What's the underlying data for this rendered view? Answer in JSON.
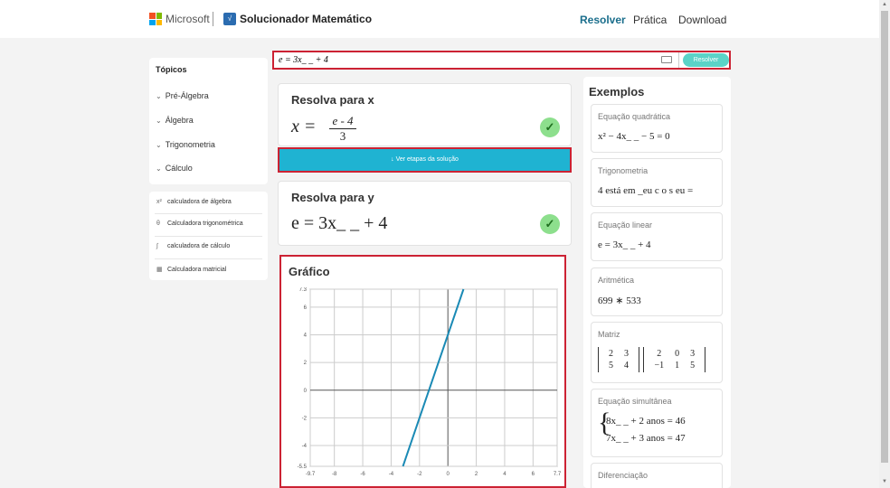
{
  "header": {
    "brand": "Microsoft",
    "app_title": "Solucionador Matemático",
    "nav": [
      "Resolver",
      "Prática",
      "Download"
    ],
    "logo_colors": [
      "#f25022",
      "#7fba00",
      "#00a4ef",
      "#ffb900"
    ]
  },
  "sidebar": {
    "topics_title": "Tópicos",
    "topics": [
      "Pré-Álgebra",
      "Álgebra",
      "Trigonometria",
      "Cálculo"
    ],
    "calculators": [
      {
        "icon": "x²",
        "label": "calculadora de álgebra"
      },
      {
        "icon": "θ",
        "label": "Calculadora trigonométrica"
      },
      {
        "icon": "∫",
        "label": "calculadora de cálculo"
      },
      {
        "icon": "▦",
        "label": "Calculadora matricial"
      }
    ]
  },
  "search": {
    "value": "e = 3x_ _ + 4",
    "button": "Resolver"
  },
  "results": {
    "solve_x_title": "Resolva para x",
    "x_var": "x",
    "x_num": "e - 4",
    "x_den": "3",
    "steps_button": "↓ Ver etapas da solução",
    "solve_y_title": "Resolva para y",
    "y_expr": "e = 3x_ _ + 4",
    "check": "✓"
  },
  "graph": {
    "title": "Gráfico"
  },
  "chart_data": {
    "type": "line",
    "title": "",
    "xlabel": "",
    "ylabel": "",
    "xlim": [
      -9.7,
      7.7
    ],
    "ylim": [
      -5.5,
      7.3
    ],
    "x_ticks": [
      "-9.7",
      "-8",
      "-6",
      "-4",
      "-2",
      "0",
      "2",
      "4",
      "6",
      "7.7"
    ],
    "y_ticks": [
      "7.3",
      "6",
      "4",
      "2",
      "0",
      "-2",
      "-4",
      "-5.5"
    ],
    "series": [
      {
        "x": [
          -3.167,
          1.1
        ],
        "y": [
          -5.5,
          7.3
        ]
      }
    ],
    "line_color": "#1a8ab5",
    "grid": true
  },
  "examples": {
    "title": "Exemplos",
    "items": [
      {
        "label": "Equação quadrática",
        "expr": "x² − 4x_ _ − 5 = 0"
      },
      {
        "label": "Trigonometria",
        "expr": "4 está em _eu c o s eu ="
      },
      {
        "label": "Equação linear",
        "expr": "e = 3x_ _ + 4"
      },
      {
        "label": "Aritmética",
        "expr": "699 ∗ 533"
      },
      {
        "label": "Matriz",
        "m1": [
          [
            "2",
            "3"
          ],
          [
            "5",
            "4"
          ]
        ],
        "m2": [
          [
            "2",
            "0",
            "3"
          ],
          [
            "−1",
            "1",
            "5"
          ]
        ]
      },
      {
        "label": "Equação simultânea",
        "l1": "8x_ _ + 2 anos = 46",
        "l2": "7x_ _ + 3 anos = 47"
      },
      {
        "label": "Diferenciação"
      }
    ]
  }
}
